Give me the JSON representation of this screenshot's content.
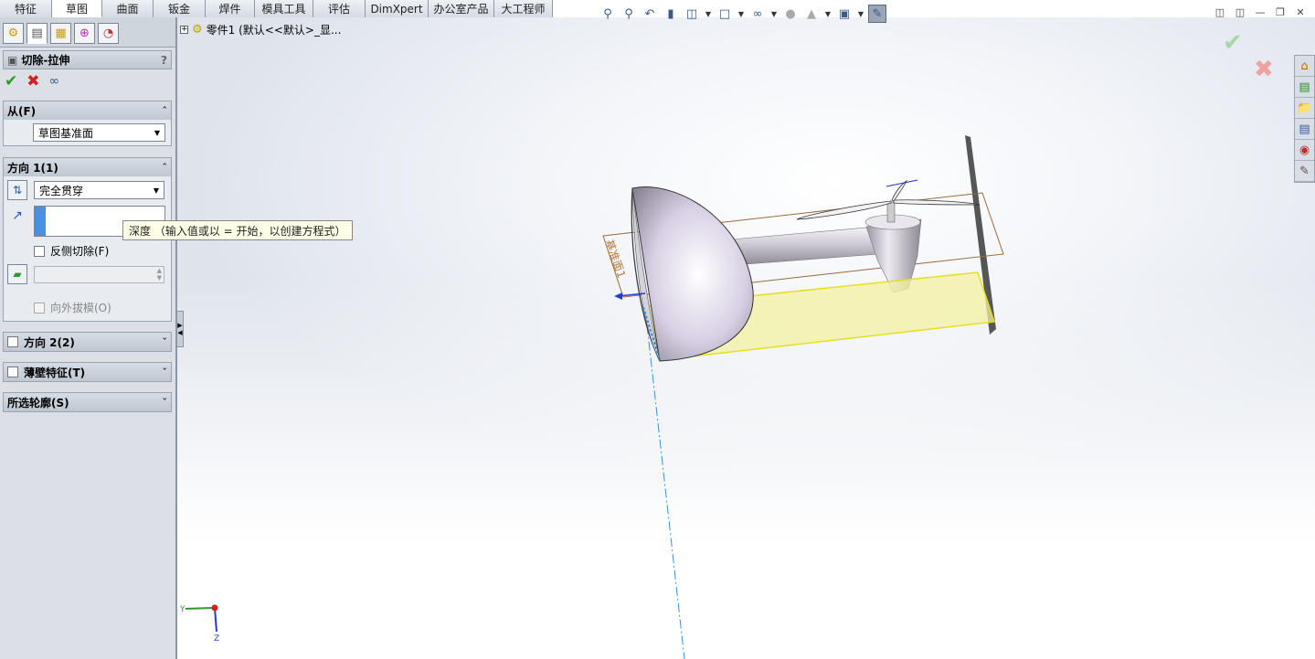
{
  "tabs": [
    "特征",
    "草图",
    "曲面",
    "钣金",
    "焊件",
    "模具工具",
    "评估",
    "DimXpert",
    "办公室产品",
    "大工程师"
  ],
  "active_tab": 1,
  "tree": {
    "expander": "+",
    "label": "零件1  (默认<<默认>_显..."
  },
  "pm": {
    "title": "切除-拉伸",
    "help": "?",
    "from": {
      "header": "从(F)",
      "value": "草图基准面"
    },
    "direction1": {
      "header": "方向 1(1)",
      "end_condition": "完全贯穿",
      "depth_value": "",
      "reverse_label": "反侧切除(F)",
      "draft_label": "向外拔模(O)"
    },
    "direction2": {
      "header": "方向 2(2)"
    },
    "thin": {
      "header": "薄壁特征(T)"
    },
    "contours": {
      "header": "所选轮廓(S)"
    }
  },
  "tooltip": "深度 （输入值或以 = 开始，以创建方程式）",
  "plane_label": "基准面1",
  "triad": {
    "y": "Y",
    "z": "Z"
  },
  "colors": {
    "accent": "#3a5a8a",
    "preview": "#f3f0a0",
    "ok_green": "#2a9a2a",
    "cancel_red": "#cc2222"
  }
}
